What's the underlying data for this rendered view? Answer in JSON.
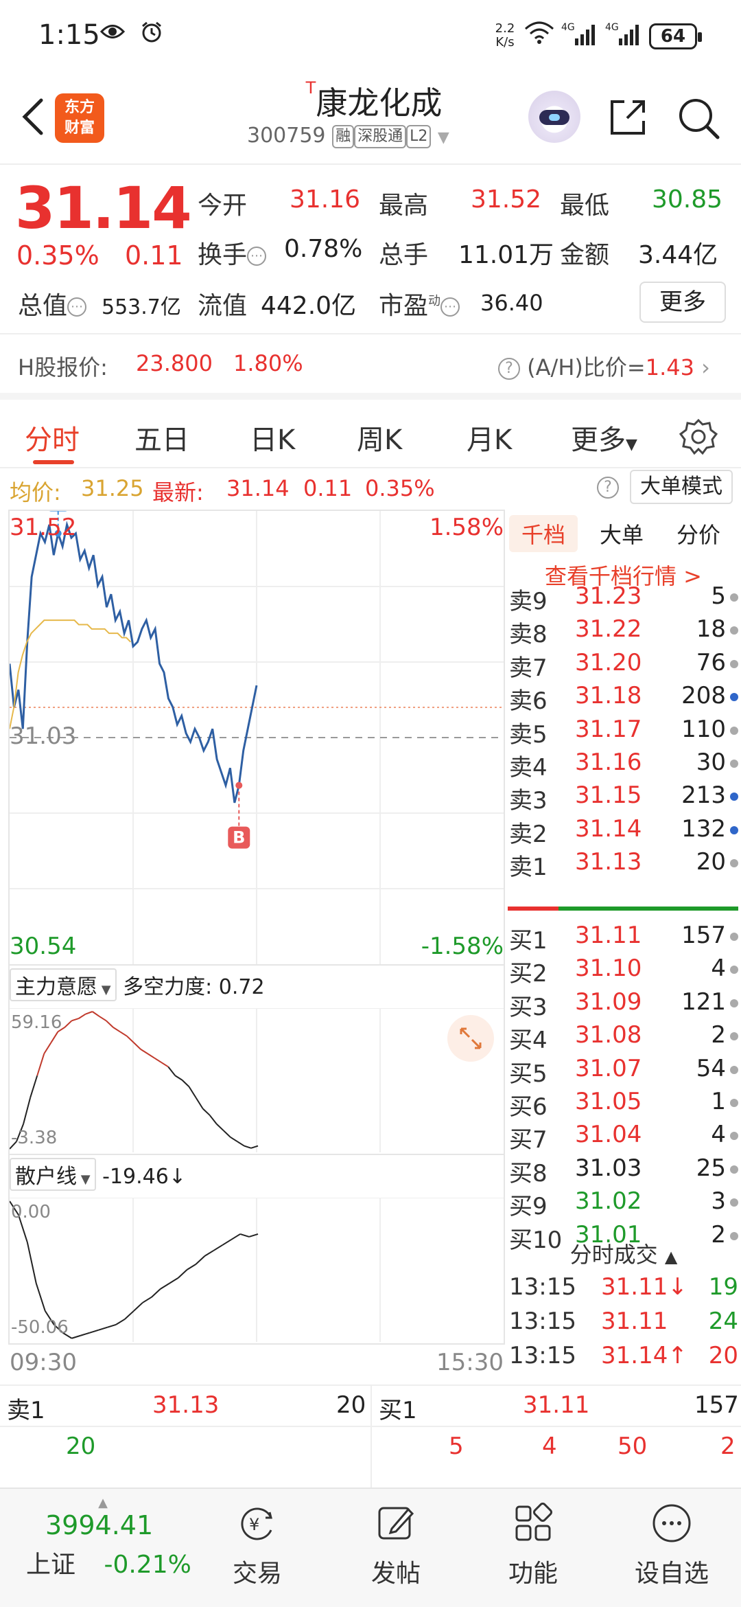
{
  "status_bar": {
    "time": "1:15",
    "net_speed_value": "2.2",
    "net_speed_unit": "K/s",
    "battery": "64"
  },
  "header": {
    "logo_line1": "东方",
    "logo_line2": "财富",
    "title_prefix": "T",
    "title": "康龙化成",
    "code": "300759",
    "tags": [
      "融",
      "深股通",
      "L2"
    ]
  },
  "quote": {
    "price": "31.14",
    "change_pct": "0.35%",
    "change": "0.11",
    "rows": [
      [
        {
          "label": "今开",
          "value": "31.16",
          "color": "red"
        },
        {
          "label": "最高",
          "value": "31.52",
          "color": "red"
        },
        {
          "label": "最低",
          "value": "30.85",
          "color": "green"
        }
      ],
      [
        {
          "label": "换手",
          "value": "0.78%",
          "color": "black"
        },
        {
          "label": "总手",
          "value": "11.01万",
          "color": "black"
        },
        {
          "label": "金额",
          "value": "3.44亿",
          "color": "black"
        }
      ],
      [
        {
          "label": "总值",
          "value": "553.7亿",
          "color": "black"
        },
        {
          "label": "流值",
          "value": "442.0亿",
          "color": "black"
        },
        {
          "label": "市盈",
          "sup": "动",
          "value": "36.40",
          "color": "black"
        }
      ]
    ],
    "more": "更多",
    "h_label": "H股报价:",
    "h_price": "23.800",
    "h_pct": "1.80%",
    "ah_label": "(A/H)比价=",
    "ah_value": "1.43"
  },
  "tabs": [
    "分时",
    "五日",
    "日K",
    "周K",
    "月K",
    "更多"
  ],
  "info_row": {
    "avg_label": "均价:",
    "avg_value": "31.25",
    "latest_label": "最新:",
    "latest_value": "31.14",
    "latest_change": "0.11",
    "latest_pct": "0.35%",
    "big_order_mode": "大单模式"
  },
  "chart_data": {
    "type": "line",
    "ylim": [
      30.54,
      31.52
    ],
    "y_labels": {
      "top": "31.52",
      "mid": "31.03",
      "bottom": "30.54",
      "top_pct": "1.58%",
      "bottom_pct": "-1.58%"
    },
    "x_labels": {
      "start": "09:30",
      "end": "15:30"
    },
    "markers": [
      {
        "label": "S"
      },
      {
        "label": "B"
      }
    ],
    "series": [
      {
        "values": [
          31.2,
          31.1,
          31.14,
          31.05,
          31.25,
          31.4,
          31.45,
          31.5,
          31.48,
          31.52,
          31.45,
          31.5,
          31.47,
          31.52,
          31.49,
          31.5,
          31.44,
          31.46,
          31.42,
          31.45,
          31.38,
          31.4,
          31.33,
          31.36,
          31.3,
          31.32,
          31.27,
          31.3,
          31.24,
          31.25,
          31.28,
          31.3,
          31.26,
          31.28,
          31.2,
          31.18,
          31.12,
          31.1,
          31.06,
          31.08,
          31.04,
          31.02,
          31.05,
          31.03,
          31.0,
          31.02,
          31.05,
          30.98,
          30.95,
          30.92,
          30.96,
          30.88,
          30.92,
          31.0,
          31.05,
          31.1,
          31.15
        ]
      },
      {
        "values": [
          31.05,
          31.1,
          31.18,
          31.22,
          31.25,
          31.27,
          31.28,
          31.29,
          31.3,
          31.3,
          31.3,
          31.3,
          31.3,
          31.3,
          31.3,
          31.3,
          31.29,
          31.29,
          31.29,
          31.28,
          31.28,
          31.28,
          31.28,
          31.27,
          31.27,
          31.27,
          31.26,
          31.26,
          31.25
        ]
      }
    ]
  },
  "sub_chart1": {
    "selector": "主力意愿",
    "metric_label": "多空力度:",
    "metric_value": "0.72",
    "ymax": "59.16",
    "ymin": "-3.38",
    "values": [
      -3.38,
      0,
      8,
      20,
      30,
      40,
      45,
      50,
      52,
      55,
      56,
      58,
      59.16,
      57,
      55,
      52,
      50,
      48,
      45,
      42,
      40,
      38,
      36,
      34,
      30,
      28,
      25,
      20,
      15,
      12,
      8,
      5,
      2,
      0,
      -2,
      -3,
      -2
    ]
  },
  "sub_chart2": {
    "selector": "散户线",
    "metric_value": "-19.46",
    "ymax": "0.00",
    "ymin": "-50.06",
    "values": [
      0,
      -5,
      -15,
      -30,
      -40,
      -45,
      -48,
      -50,
      -49,
      -48,
      -47,
      -46,
      -45,
      -43,
      -40,
      -37,
      -35,
      -32,
      -30,
      -28,
      -25,
      -23,
      -20,
      -18,
      -16,
      -14,
      -12,
      -13,
      -12
    ]
  },
  "order_book": {
    "tabs": [
      "千档",
      "大单",
      "分价"
    ],
    "link": "查看千档行情 >",
    "asks": [
      {
        "label": "卖9",
        "price": "31.23",
        "vol": "5",
        "dot": "gray",
        "color": "red"
      },
      {
        "label": "卖8",
        "price": "31.22",
        "vol": "18",
        "dot": "gray",
        "color": "red"
      },
      {
        "label": "卖7",
        "price": "31.20",
        "vol": "76",
        "dot": "gray",
        "color": "red"
      },
      {
        "label": "卖6",
        "price": "31.18",
        "vol": "208",
        "dot": "blue",
        "color": "red"
      },
      {
        "label": "卖5",
        "price": "31.17",
        "vol": "110",
        "dot": "gray",
        "color": "red"
      },
      {
        "label": "卖4",
        "price": "31.16",
        "vol": "30",
        "dot": "gray",
        "color": "red"
      },
      {
        "label": "卖3",
        "price": "31.15",
        "vol": "213",
        "dot": "blue",
        "color": "red"
      },
      {
        "label": "卖2",
        "price": "31.14",
        "vol": "132",
        "dot": "blue",
        "color": "red"
      },
      {
        "label": "卖1",
        "price": "31.13",
        "vol": "20",
        "dot": "gray",
        "color": "red"
      }
    ],
    "bids": [
      {
        "label": "买1",
        "price": "31.11",
        "vol": "157",
        "dot": "gray",
        "color": "red"
      },
      {
        "label": "买2",
        "price": "31.10",
        "vol": "4",
        "dot": "gray",
        "color": "red"
      },
      {
        "label": "买3",
        "price": "31.09",
        "vol": "121",
        "dot": "gray",
        "color": "red"
      },
      {
        "label": "买4",
        "price": "31.08",
        "vol": "2",
        "dot": "gray",
        "color": "red"
      },
      {
        "label": "买5",
        "price": "31.07",
        "vol": "54",
        "dot": "gray",
        "color": "red"
      },
      {
        "label": "买6",
        "price": "31.05",
        "vol": "1",
        "dot": "gray",
        "color": "red"
      },
      {
        "label": "买7",
        "price": "31.04",
        "vol": "4",
        "dot": "gray",
        "color": "red"
      },
      {
        "label": "买8",
        "price": "31.03",
        "vol": "25",
        "dot": "gray",
        "color": "black"
      },
      {
        "label": "买9",
        "price": "31.02",
        "vol": "3",
        "dot": "gray",
        "color": "green"
      },
      {
        "label": "买10",
        "price": "31.01",
        "vol": "2",
        "dot": "gray",
        "color": "green"
      }
    ],
    "ticks_header": "分时成交",
    "ticks": [
      {
        "time": "13:15",
        "price": "31.11",
        "arrow": "↓",
        "vol": "19",
        "vcolor": "green"
      },
      {
        "time": "13:15",
        "price": "31.11",
        "arrow": "",
        "vol": "24",
        "vcolor": "green"
      },
      {
        "time": "13:15",
        "price": "31.14",
        "arrow": "↑",
        "vol": "20",
        "vcolor": "red"
      }
    ]
  },
  "strip": {
    "ask_label": "卖1",
    "ask_price": "31.13",
    "ask_vol": "20",
    "bid_label": "买1",
    "bid_price": "31.11",
    "bid_vol": "157",
    "ask_detail": [
      "20"
    ],
    "bid_detail": [
      "5",
      "4",
      "50",
      "2"
    ]
  },
  "bottom_nav": {
    "index_value": "3994.41",
    "index_name": "上证",
    "index_pct": "-0.21%",
    "items": [
      "交易",
      "发帖",
      "功能",
      "设自选"
    ]
  },
  "colors": {
    "up": "#e8312f",
    "down": "#1e9a2a",
    "accent": "#e8402a",
    "price_line": "#2e5fa3",
    "avg_line": "#e6b84a"
  }
}
